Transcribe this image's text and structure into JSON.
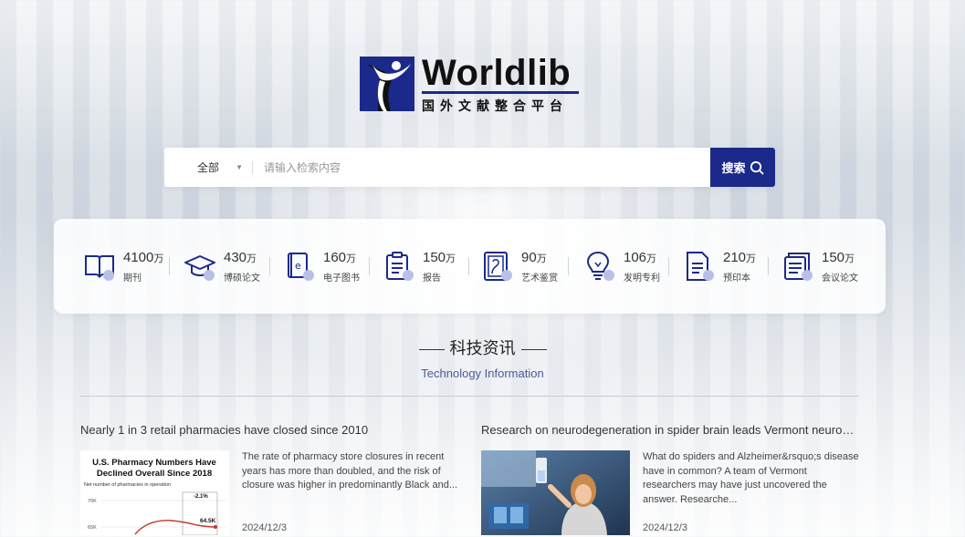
{
  "brand": {
    "name": "Worldlib",
    "subtitle": "国外文献整合平台"
  },
  "search": {
    "scope": "全部",
    "placeholder": "请输入检索内容",
    "button_label": "搜索"
  },
  "stats": [
    {
      "icon": "periodical-icon",
      "num": "4100",
      "unit": "万",
      "label": "期刊"
    },
    {
      "icon": "graduation-cap-icon",
      "num": "430",
      "unit": "万",
      "label": "博硕论文"
    },
    {
      "icon": "ebook-icon",
      "num": "160",
      "unit": "万",
      "label": "电子图书"
    },
    {
      "icon": "report-clipboard-icon",
      "num": "150",
      "unit": "万",
      "label": "报告"
    },
    {
      "icon": "art-frame-icon",
      "num": "90",
      "unit": "万",
      "label": "艺术鉴赏"
    },
    {
      "icon": "lightbulb-icon",
      "num": "106",
      "unit": "万",
      "label": "发明专利"
    },
    {
      "icon": "preprint-icon",
      "num": "210",
      "unit": "万",
      "label": "预印本"
    },
    {
      "icon": "conference-paper-icon",
      "num": "150",
      "unit": "万",
      "label": "会议论文"
    }
  ],
  "section": {
    "title": "科技资讯",
    "subtitle": "Technology Information"
  },
  "news": [
    {
      "headline": "Nearly 1 in 3 retail pharmacies have closed since 2010",
      "summary": "The rate of pharmacy store closures in recent years has more than doubled, and the risk of closure was higher in predominantly Black and...",
      "date": "2024/12/3",
      "thumb": {
        "title_line1": "U.S. Pharmacy Numbers Have",
        "title_line2": "Declined Overall Since 2018",
        "caption": "Net number of pharmacies in operation",
        "tick_top": "70K",
        "tick_bottom": "65K",
        "change": "-2.1%",
        "end_value": "64.5K"
      }
    },
    {
      "headline": "Research on neurodegeneration in spider brain leads Vermont neuroscient...",
      "summary": "What do spiders and Alzheimer&rsquo;s disease have in common? A team of Vermont researchers may have just uncovered the answer. Researche...",
      "date": "2024/12/3"
    }
  ],
  "colors": {
    "brand_blue": "#1b2a8a",
    "icon_accent": "#b9c0e8"
  }
}
